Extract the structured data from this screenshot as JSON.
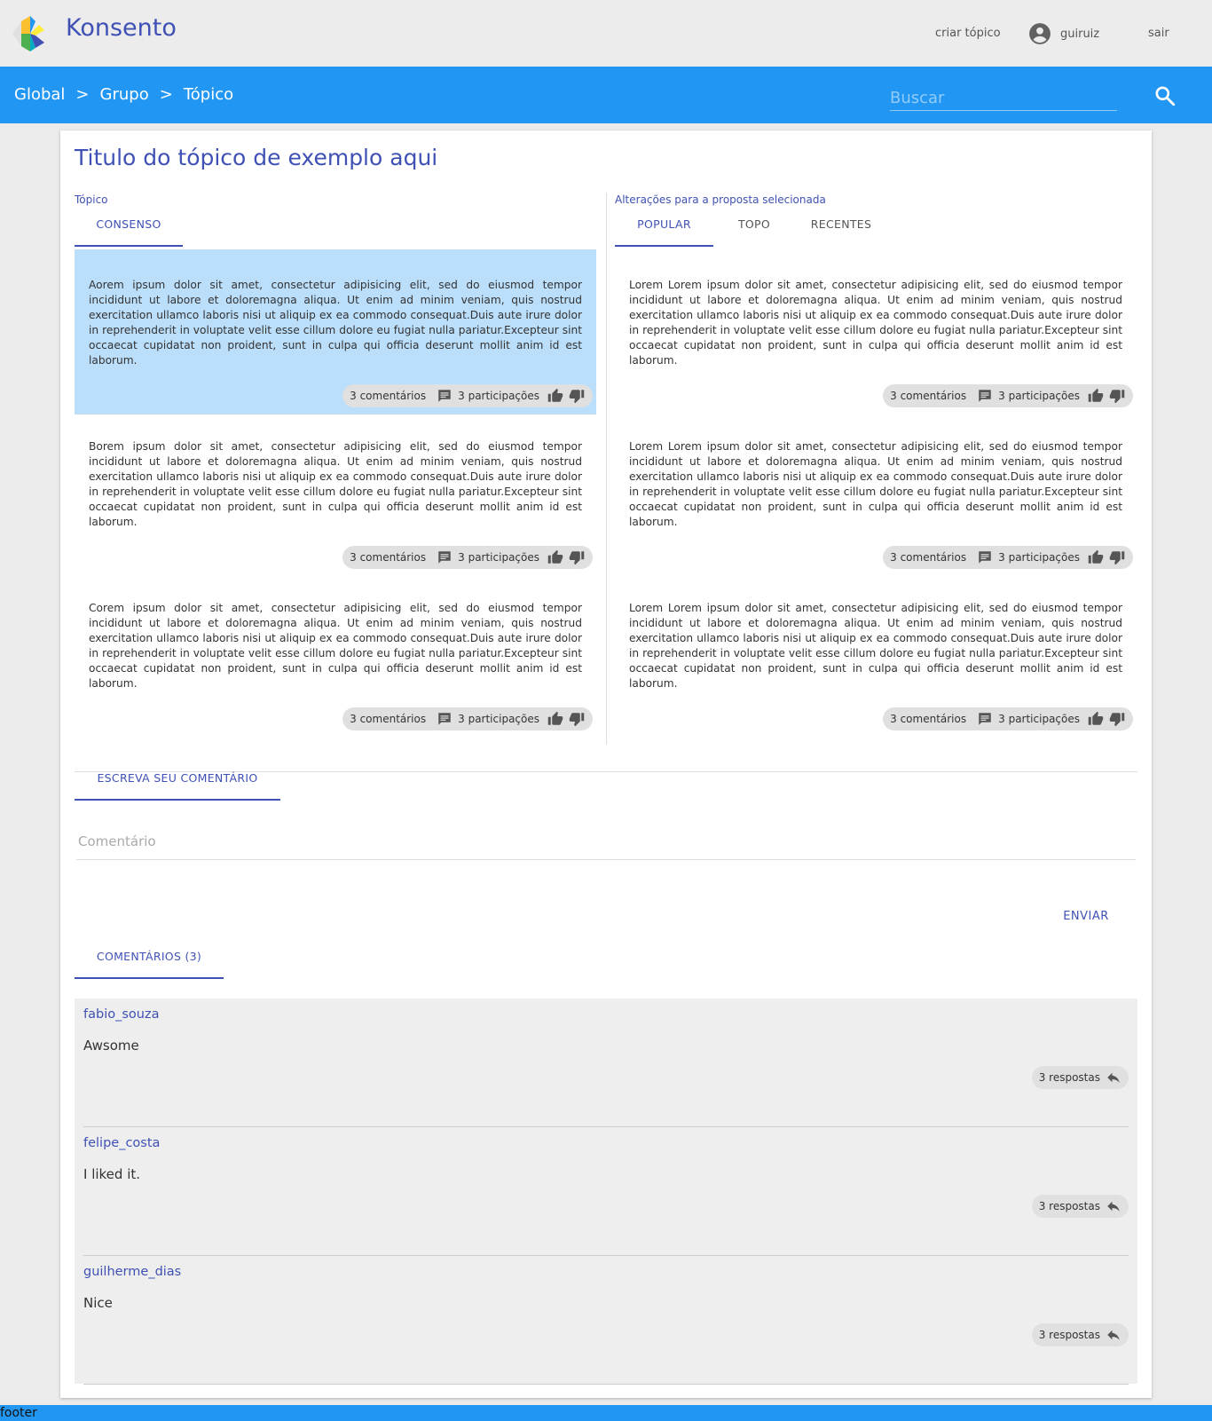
{
  "header": {
    "brand": "Konsento",
    "create_topic": "criar tópico",
    "username": "guiruiz",
    "logout": "sair"
  },
  "breadcrumb": [
    "Global",
    "Grupo",
    "Tópico"
  ],
  "breadcrumb_separator": ">",
  "search": {
    "placeholder": "Buscar"
  },
  "topic": {
    "title": "Titulo do tópico de exemplo aqui",
    "left_label": "Tópico",
    "right_label": "Alterações para a proposta selecionada",
    "left_tabs": [
      "CONSENSO"
    ],
    "right_tabs": [
      "POPULAR",
      "TOPO",
      "RECENTES"
    ]
  },
  "proposals_left": [
    {
      "text": "Aorem ipsum dolor sit amet, consectetur adipisicing elit, sed do eiusmod tempor incididunt ut labore et doloremagna aliqua. Ut enim ad minim veniam, quis nostrud exercitation ullamco laboris nisi ut aliquip ex ea commodo consequat.Duis aute irure dolor in reprehenderit in voluptate velit esse cillum dolore eu fugiat nulla pariatur.Excepteur sint occaecat cupidatat non proident, sunt in culpa qui officia deserunt mollit anim id est laborum.",
      "comments": "3 comentários",
      "participations": "3 participações",
      "selected": true
    },
    {
      "text": "Borem ipsum dolor sit amet, consectetur adipisicing elit, sed do eiusmod tempor incididunt ut labore et doloremagna aliqua. Ut enim ad minim veniam, quis nostrud exercitation ullamco laboris nisi ut aliquip ex ea commodo consequat.Duis aute irure dolor in reprehenderit in voluptate velit esse cillum dolore eu fugiat nulla pariatur.Excepteur sint occaecat cupidatat non proident, sunt in culpa qui officia deserunt mollit anim id est laborum.",
      "comments": "3 comentários",
      "participations": "3 participações",
      "selected": false
    },
    {
      "text": "Corem ipsum dolor sit amet, consectetur adipisicing elit, sed do eiusmod tempor incididunt ut labore et doloremagna aliqua. Ut enim ad minim veniam, quis nostrud exercitation ullamco laboris nisi ut aliquip ex ea commodo consequat.Duis aute irure dolor in reprehenderit in voluptate velit esse cillum dolore eu fugiat nulla pariatur.Excepteur sint occaecat cupidatat non proident, sunt in culpa qui officia deserunt mollit anim id est laborum.",
      "comments": "3 comentários",
      "participations": "3 participações",
      "selected": false
    }
  ],
  "proposals_right": [
    {
      "text": "Lorem Lorem ipsum dolor sit amet, consectetur adipisicing elit, sed do eiusmod tempor incididunt ut labore et doloremagna aliqua. Ut enim ad minim veniam, quis nostrud exercitation ullamco laboris nisi ut aliquip ex ea commodo consequat.Duis aute irure dolor in reprehenderit in voluptate velit esse cillum dolore eu fugiat nulla pariatur.Excepteur sint occaecat cupidatat non proident, sunt in culpa qui officia deserunt mollit anim id est laborum.",
      "comments": "3 comentários",
      "participations": "3 participações"
    },
    {
      "text": "Lorem Lorem ipsum dolor sit amet, consectetur adipisicing elit, sed do eiusmod tempor incididunt ut labore et doloremagna aliqua. Ut enim ad minim veniam, quis nostrud exercitation ullamco laboris nisi ut aliquip ex ea commodo consequat.Duis aute irure dolor in reprehenderit in voluptate velit esse cillum dolore eu fugiat nulla pariatur.Excepteur sint occaecat cupidatat non proident, sunt in culpa qui officia deserunt mollit anim id est laborum.",
      "comments": "3 comentários",
      "participations": "3 participações"
    },
    {
      "text": "Lorem Lorem ipsum dolor sit amet, consectetur adipisicing elit, sed do eiusmod tempor incididunt ut labore et doloremagna aliqua. Ut enim ad minim veniam, quis nostrud exercitation ullamco laboris nisi ut aliquip ex ea commodo consequat.Duis aute irure dolor in reprehenderit in voluptate velit esse cillum dolore eu fugiat nulla pariatur.Excepteur sint occaecat cupidatat non proident, sunt in culpa qui officia deserunt mollit anim id est laborum.",
      "comments": "3 comentários",
      "participations": "3 participações"
    }
  ],
  "write_comment": {
    "tab": "ESCREVA SEU COMENTÁRIO",
    "placeholder": "Comentário",
    "send": "ENVIAR"
  },
  "comments_section": {
    "tab": "COMENTÁRIOS (3)",
    "items": [
      {
        "user": "fabio_souza",
        "text": "Awsome",
        "replies": "3 respostas"
      },
      {
        "user": "felipe_costa",
        "text": "I liked it.",
        "replies": "3 respostas"
      },
      {
        "user": "guilherme_dias",
        "text": "Nice",
        "replies": "3 respostas"
      }
    ]
  },
  "footer": {
    "text": "footer"
  },
  "colors": {
    "primary": "#2196f3",
    "indigo": "#3f51b5",
    "selected_bg": "#bbdefb",
    "page_bg": "#ebebeb"
  },
  "icons": [
    "konsento-logo",
    "account-circle-icon",
    "search-icon",
    "comment-icon",
    "thumb-up-icon",
    "thumb-down-icon",
    "reply-icon"
  ]
}
